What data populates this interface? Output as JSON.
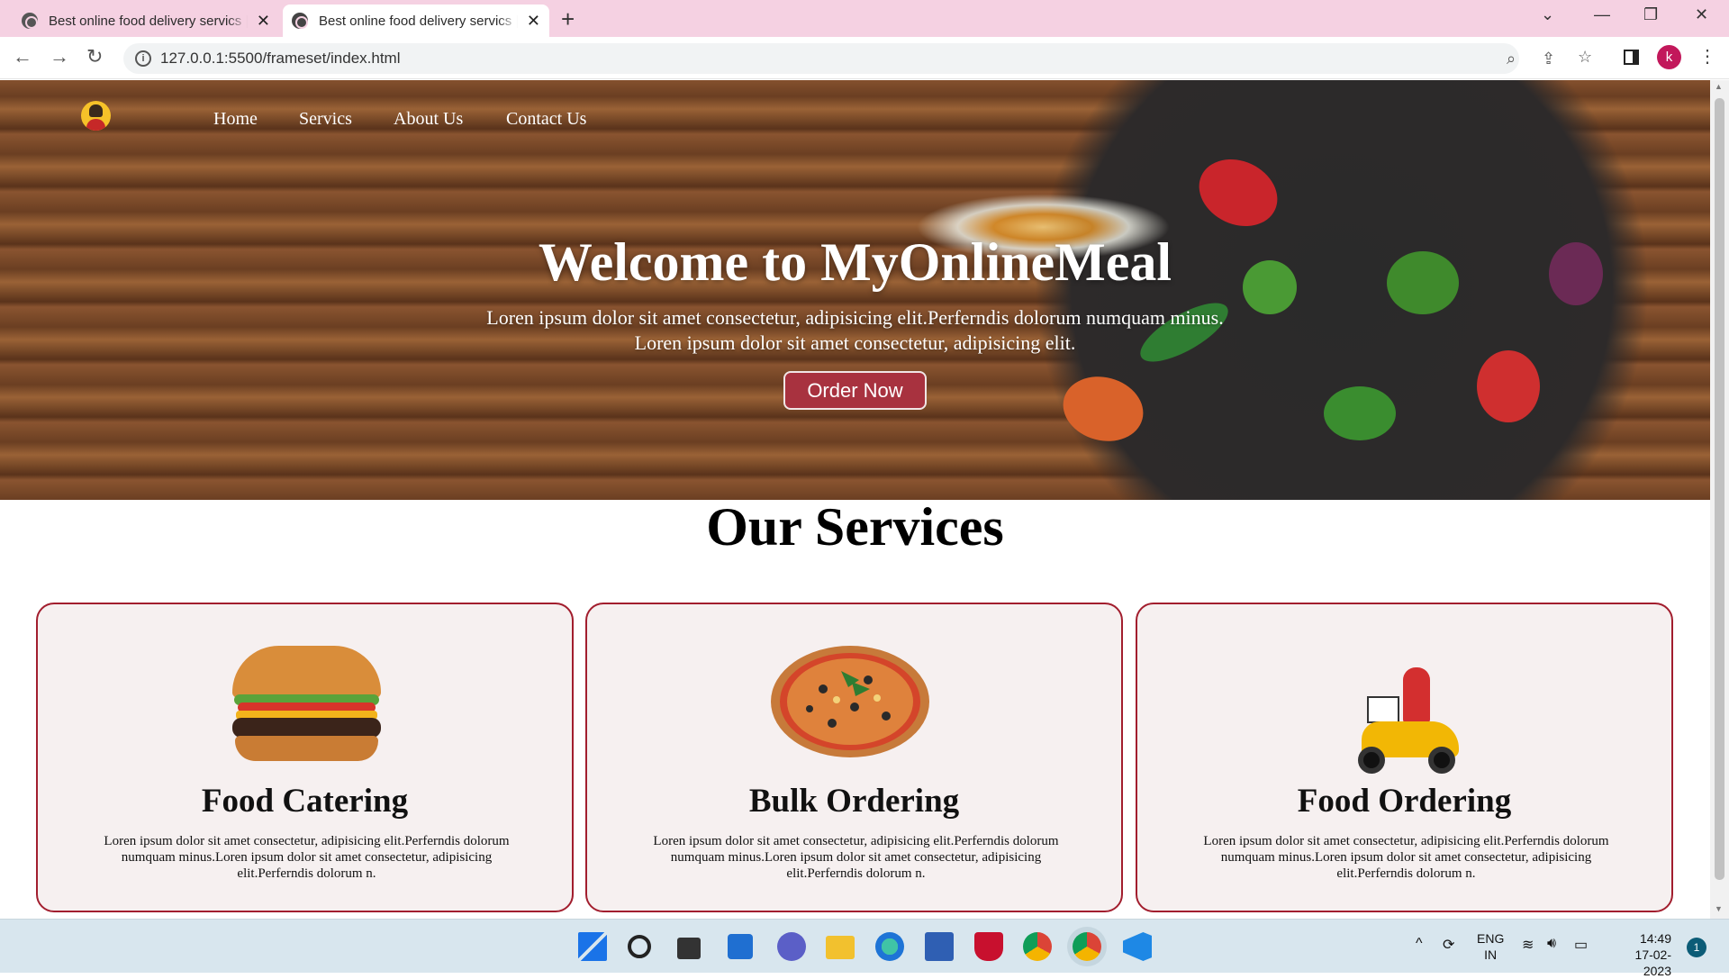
{
  "browser": {
    "tabs": [
      {
        "title": "Best online food delivery servics |"
      },
      {
        "title": "Best online food delivery servics |"
      }
    ],
    "url": "127.0.0.1:5500/frameset/index.html",
    "profile_initial": "k"
  },
  "nav": {
    "links": [
      "Home",
      "Servics",
      "About Us",
      "Contact Us"
    ]
  },
  "hero": {
    "title": "Welcome to MyOnlineMeal",
    "text_line1": "Loren ipsum dolor sit amet consectetur, adipisicing elit.Perferndis dolorum numquam minus.",
    "text_line2": "Loren ipsum dolor sit amet consectetur, adipisicing elit.",
    "button": "Order Now"
  },
  "services": {
    "title": "Our Services",
    "cards": [
      {
        "title": "Food Catering",
        "text": "Loren ipsum dolor sit amet consectetur, adipisicing elit.Perferndis dolorum numquam minus.Loren ipsum dolor sit amet consectetur, adipisicing elit.Perferndis dolorum n.",
        "icon": "burger-image"
      },
      {
        "title": "Bulk Ordering",
        "text": "Loren ipsum dolor sit amet consectetur, adipisicing elit.Perferndis dolorum numquam minus.Loren ipsum dolor sit amet consectetur, adipisicing elit.Perferndis dolorum n.",
        "icon": "pizza-image"
      },
      {
        "title": "Food Ordering",
        "text": "Loren ipsum dolor sit amet consectetur, adipisicing elit.Perferndis dolorum numquam minus.Loren ipsum dolor sit amet consectetur, adipisicing elit.Perferndis dolorum n.",
        "icon": "delivery-scooter-image"
      }
    ]
  },
  "taskbar": {
    "lang": "ENG",
    "region": "IN",
    "time": "14:49",
    "date": "17-02-2023",
    "notifications": "1"
  },
  "colors": {
    "tabbar": "#f5d1e2",
    "accent": "#a8323f",
    "card_border": "#a21e2e",
    "card_bg": "#f6f0f0"
  }
}
